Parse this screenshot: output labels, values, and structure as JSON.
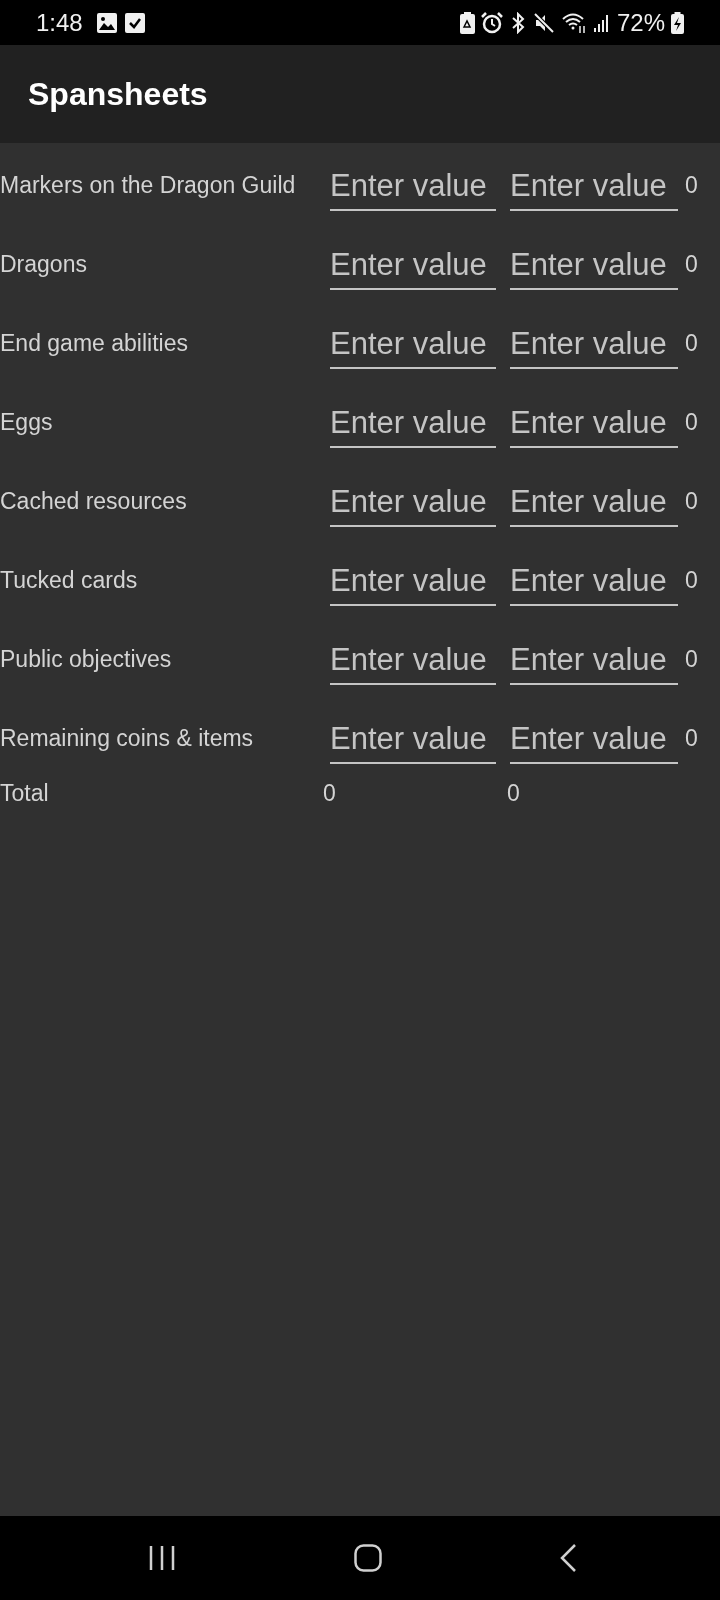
{
  "status_bar": {
    "time": "1:48",
    "battery": "72%"
  },
  "app_bar": {
    "title": "Spansheets"
  },
  "rows": [
    {
      "label": "Markers on the Dragon Guild",
      "fields": [
        {
          "placeholder": "Enter value"
        },
        {
          "placeholder": "Enter value"
        }
      ],
      "total": "0"
    },
    {
      "label": "Dragons",
      "fields": [
        {
          "placeholder": "Enter value"
        },
        {
          "placeholder": "Enter value"
        }
      ],
      "total": "0"
    },
    {
      "label": "End game abilities",
      "fields": [
        {
          "placeholder": "Enter value"
        },
        {
          "placeholder": "Enter value"
        }
      ],
      "total": "0"
    },
    {
      "label": "Eggs",
      "fields": [
        {
          "placeholder": "Enter value"
        },
        {
          "placeholder": "Enter value"
        }
      ],
      "total": "0"
    },
    {
      "label": "Cached resources",
      "fields": [
        {
          "placeholder": "Enter value"
        },
        {
          "placeholder": "Enter value"
        }
      ],
      "total": "0"
    },
    {
      "label": "Tucked cards",
      "fields": [
        {
          "placeholder": "Enter value"
        },
        {
          "placeholder": "Enter value"
        }
      ],
      "total": "0"
    },
    {
      "label": "Public objectives",
      "fields": [
        {
          "placeholder": "Enter value"
        },
        {
          "placeholder": "Enter value"
        }
      ],
      "total": "0"
    },
    {
      "label": "Remaining coins & items",
      "fields": [
        {
          "placeholder": "Enter value"
        },
        {
          "placeholder": "Enter value"
        }
      ],
      "total": "0"
    }
  ],
  "total_row": {
    "label": "Total",
    "values": [
      "0",
      "0"
    ]
  }
}
